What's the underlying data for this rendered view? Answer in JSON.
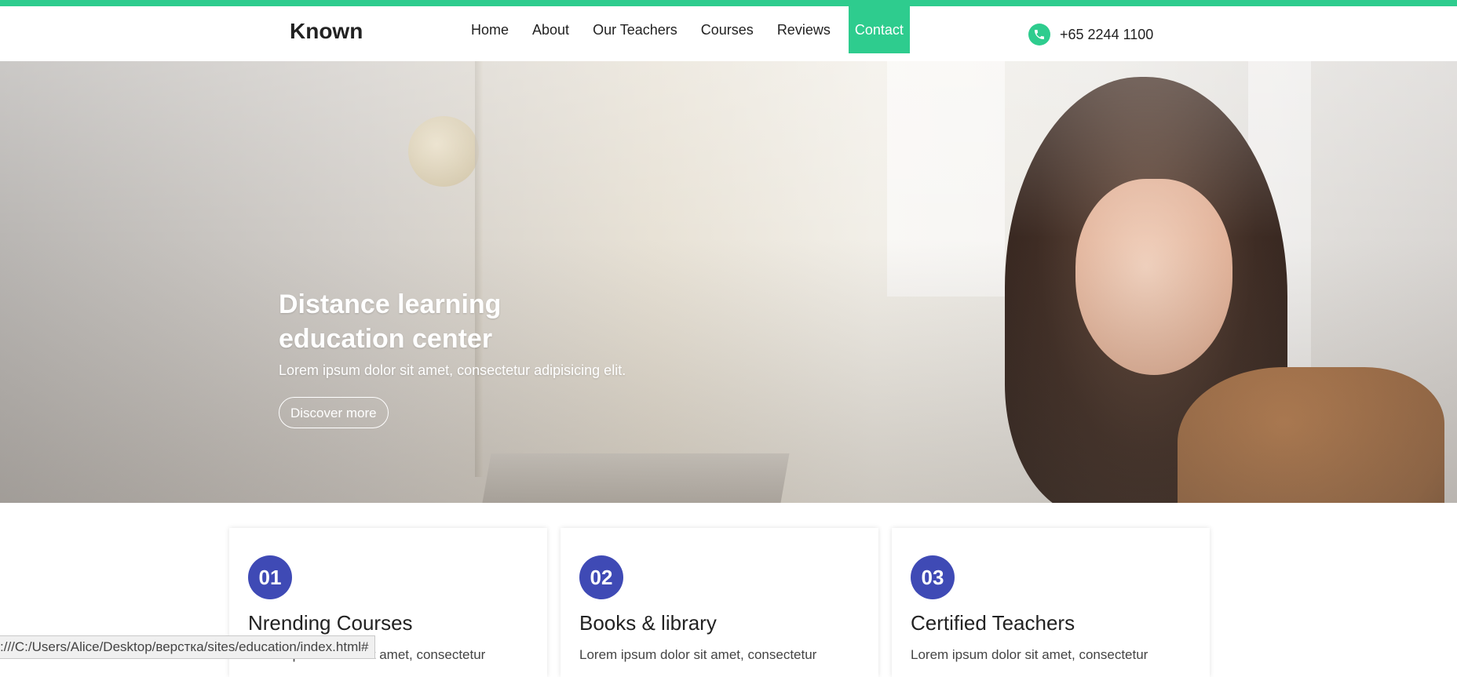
{
  "header": {
    "logo": "Known",
    "nav": [
      {
        "label": "Home"
      },
      {
        "label": "About"
      },
      {
        "label": "Our Teachers"
      },
      {
        "label": "Courses"
      },
      {
        "label": "Reviews"
      },
      {
        "label": "Contact",
        "active": true
      }
    ],
    "phone": "+65 2244 1100",
    "phone_icon": "phone-icon"
  },
  "hero": {
    "title": "Distance learning education center",
    "subtitle": "Lorem ipsum dolor sit amet, consectetur adipisicing elit.",
    "button": "Discover more"
  },
  "features": [
    {
      "number": "01",
      "title": "Nrending Courses",
      "text": "Lorem ipsum dolor sit amet, consectetur"
    },
    {
      "number": "02",
      "title": "Books & library",
      "text": "Lorem ipsum dolor sit amet, consectetur"
    },
    {
      "number": "03",
      "title": "Certified Teachers",
      "text": "Lorem ipsum dolor sit amet, consectetur"
    }
  ],
  "status_bar": {
    "url": ":///C:/Users/Alice/Desktop/верстка/sites/education/index.html#"
  },
  "colors": {
    "accent": "#2ecc8e",
    "badge": "#3f4ab5"
  }
}
